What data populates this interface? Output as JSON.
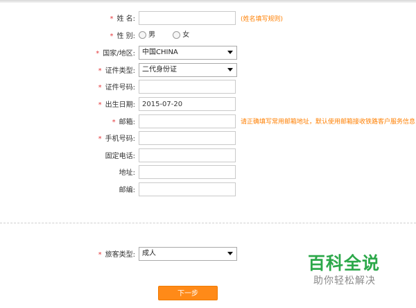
{
  "form": {
    "required_mark": "*",
    "name": {
      "label": "姓 名:",
      "value": "",
      "hint": "(姓名填写规则)"
    },
    "gender": {
      "label": "性 别:",
      "options": [
        "男",
        "女"
      ]
    },
    "country": {
      "label": "国家/地区:",
      "value": "中国CHINA"
    },
    "id_type": {
      "label": "证件类型:",
      "value": "二代身份证"
    },
    "id_number": {
      "label": "证件号码:",
      "value": ""
    },
    "birth_date": {
      "label": "出生日期:",
      "value": "2015-07-20"
    },
    "email": {
      "label": "邮箱:",
      "value": "",
      "hint": "请正确填写常用邮箱地址，默认使用邮箱接收铁路客户服务信息"
    },
    "mobile": {
      "label": "手机号码:",
      "value": ""
    },
    "landline": {
      "label": "固定电话:",
      "value": ""
    },
    "address": {
      "label": "地址:",
      "value": ""
    },
    "postcode": {
      "label": "邮编:",
      "value": ""
    },
    "passenger_type": {
      "label": "旅客类型:",
      "value": "成人"
    },
    "next_button": "下一步"
  },
  "watermark": {
    "main": "百科全说",
    "sub": "助你轻松解决"
  }
}
